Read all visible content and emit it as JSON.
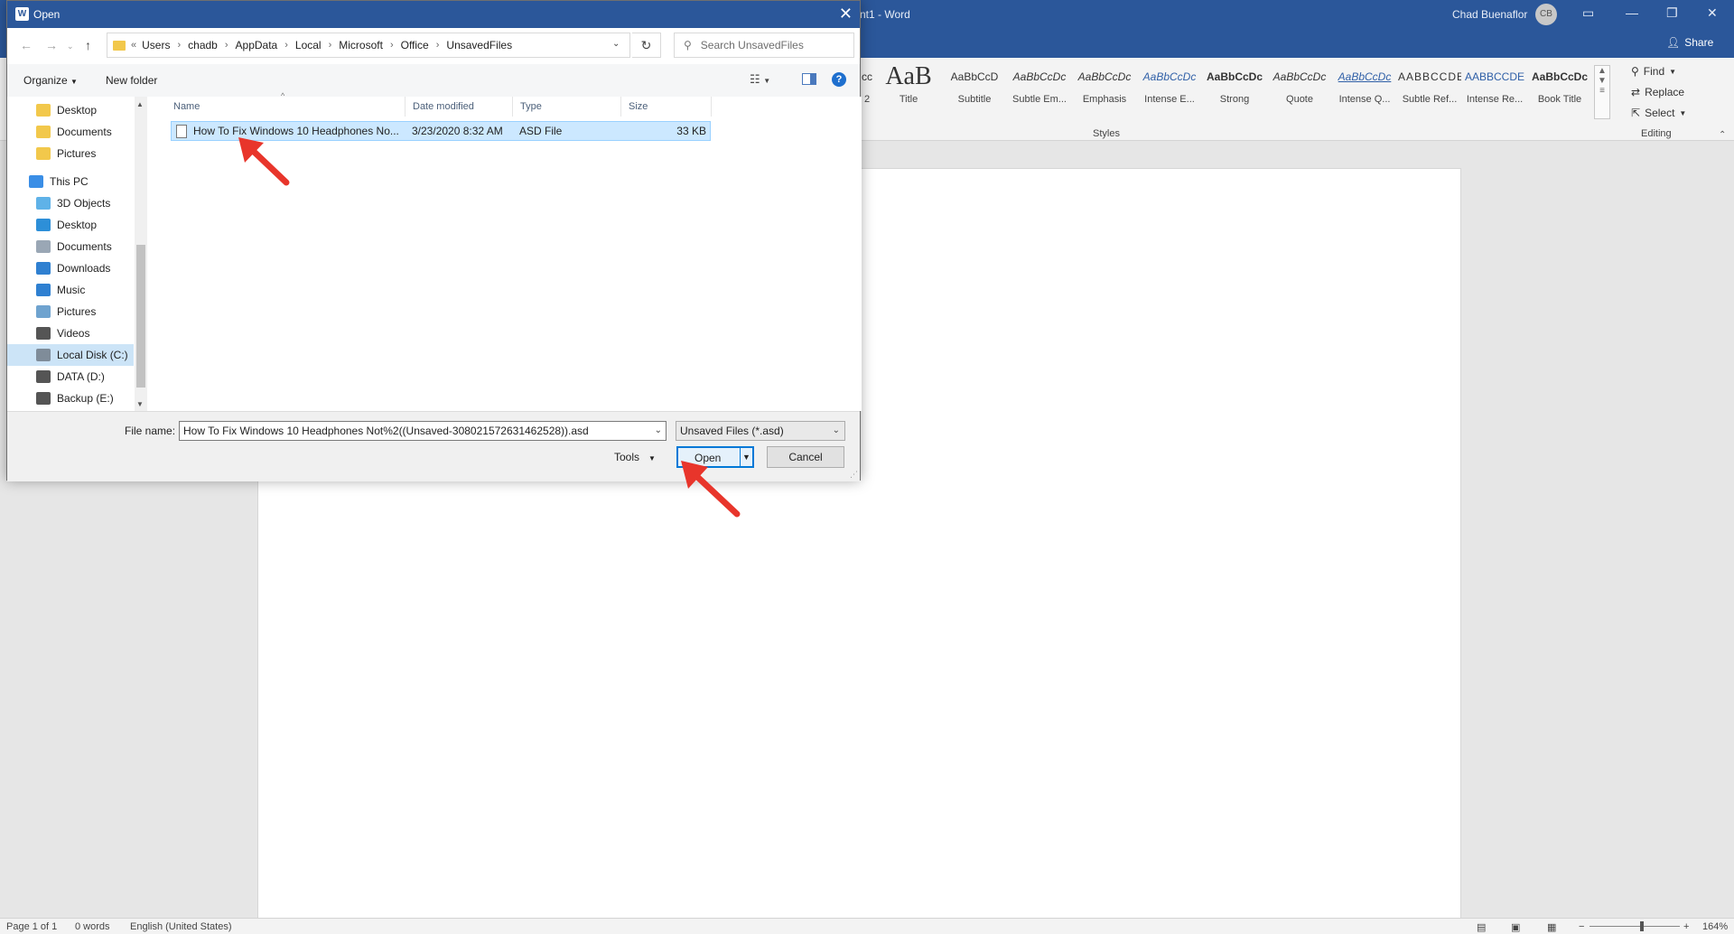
{
  "word": {
    "title": "nt1  -  Word",
    "user_name": "Chad Buenaflor",
    "user_initials": "CB",
    "share_label": "Share",
    "styles": [
      {
        "preview": "cc",
        "label": "2"
      },
      {
        "preview": "AaB",
        "label": "Title"
      },
      {
        "preview": "AaBbCcD",
        "label": "Subtitle"
      },
      {
        "preview": "AaBbCcDc",
        "label": "Subtle Em..."
      },
      {
        "preview": "AaBbCcDc",
        "label": "Emphasis"
      },
      {
        "preview": "AaBbCcDc",
        "label": "Intense E..."
      },
      {
        "preview": "AaBbCcDc",
        "label": "Strong"
      },
      {
        "preview": "AaBbCcDc",
        "label": "Quote"
      },
      {
        "preview": "AaBbCcDc",
        "label": "Intense Q..."
      },
      {
        "preview": "AABBCCDE",
        "label": "Subtle Ref..."
      },
      {
        "preview": "AABBCCDE",
        "label": "Intense Re..."
      },
      {
        "preview": "AaBbCcDc",
        "label": "Book Title"
      }
    ],
    "styles_group_label": "Styles",
    "editing": {
      "find": "Find",
      "replace": "Replace",
      "select": "Select",
      "group_label": "Editing"
    },
    "status": {
      "page": "Page 1 of 1",
      "words": "0 words",
      "language": "English (United States)",
      "zoom": "164%"
    }
  },
  "dialog": {
    "title": "Open",
    "breadcrumb_overflow": "«",
    "breadcrumb": [
      "Users",
      "chadb",
      "AppData",
      "Local",
      "Microsoft",
      "Office",
      "UnsavedFiles"
    ],
    "search_placeholder": "Search UnsavedFiles",
    "organize_label": "Organize",
    "new_folder_label": "New folder",
    "help_label": "?",
    "nav_items": [
      {
        "label": "Desktop",
        "icon": "folder-icon",
        "color": "#f2c84b"
      },
      {
        "label": "Documents",
        "icon": "folder-icon",
        "color": "#f2c84b"
      },
      {
        "label": "Pictures",
        "icon": "folder-icon",
        "color": "#f2c84b"
      },
      {
        "label": "This PC",
        "icon": "computer-icon",
        "color": "#3a8ee6"
      },
      {
        "label": "3D Objects",
        "icon": "cube-icon",
        "color": "#5fb2e8"
      },
      {
        "label": "Desktop",
        "icon": "desktop-icon",
        "color": "#2d8fd8"
      },
      {
        "label": "Documents",
        "icon": "document-icon",
        "color": "#9aa7b5"
      },
      {
        "label": "Downloads",
        "icon": "download-icon",
        "color": "#2f80d1"
      },
      {
        "label": "Music",
        "icon": "music-icon",
        "color": "#2f80d1"
      },
      {
        "label": "Pictures",
        "icon": "picture-icon",
        "color": "#6fa3cf"
      },
      {
        "label": "Videos",
        "icon": "video-icon",
        "color": "#555555"
      },
      {
        "label": "Local Disk (C:)",
        "icon": "drive-icon",
        "color": "#7f8c99"
      },
      {
        "label": "DATA (D:)",
        "icon": "drive-icon",
        "color": "#555555"
      },
      {
        "label": "Backup (E:)",
        "icon": "drive-icon",
        "color": "#555555"
      }
    ],
    "columns": {
      "name": "Name",
      "date": "Date modified",
      "type": "Type",
      "size": "Size"
    },
    "files": [
      {
        "name": "How To Fix Windows 10 Headphones No...",
        "date": "3/23/2020 8:32 AM",
        "type": "ASD File",
        "size": "33 KB"
      }
    ],
    "filename_label": "File name:",
    "filename_value": "How To Fix Windows 10 Headphones Not%2((Unsaved-308021572631462528)).asd",
    "filetype_value": "Unsaved Files (*.asd)",
    "tools_label": "Tools",
    "open_label": "Open",
    "cancel_label": "Cancel"
  },
  "colors": {
    "accent": "#2b579a",
    "selection": "#cce8ff",
    "annotation_arrow": "#e8352b"
  }
}
